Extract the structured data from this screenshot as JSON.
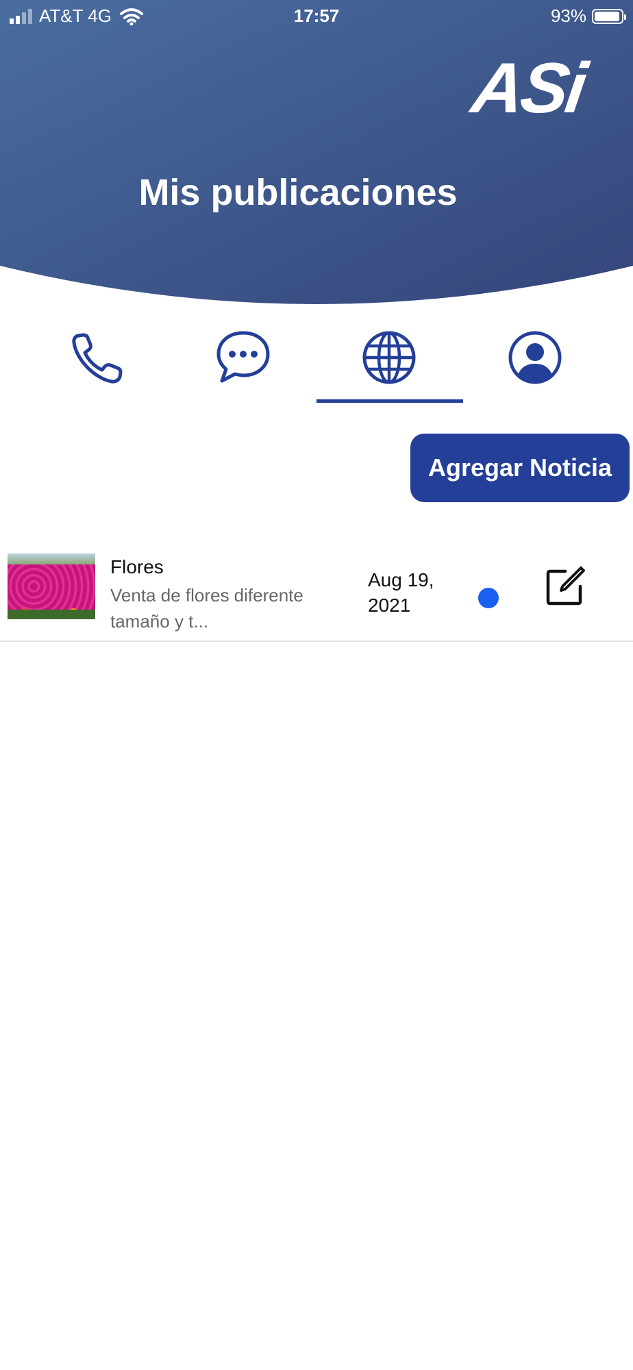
{
  "status_bar": {
    "carrier": "AT&T 4G",
    "time": "17:57",
    "battery": "93%"
  },
  "header": {
    "logo": "ASi",
    "title": "Mis publicaciones",
    "colors": {
      "gradient_start": "#4a6da0",
      "gradient_end": "#34457a"
    }
  },
  "tabs": [
    {
      "icon": "phone-icon",
      "active": false
    },
    {
      "icon": "chat-bubble-icon",
      "active": false
    },
    {
      "icon": "globe-icon",
      "active": true
    },
    {
      "icon": "user-profile-icon",
      "active": false
    }
  ],
  "actions": {
    "add_news_label": "Agregar Noticia"
  },
  "publications": [
    {
      "title": "Flores",
      "description": "Venta de flores diferente tamaño y t...",
      "date": "Aug 19, 2021",
      "status_color": "#1a5ff0",
      "action_icon": "edit-icon"
    }
  ],
  "colors": {
    "accent": "#233f98"
  }
}
